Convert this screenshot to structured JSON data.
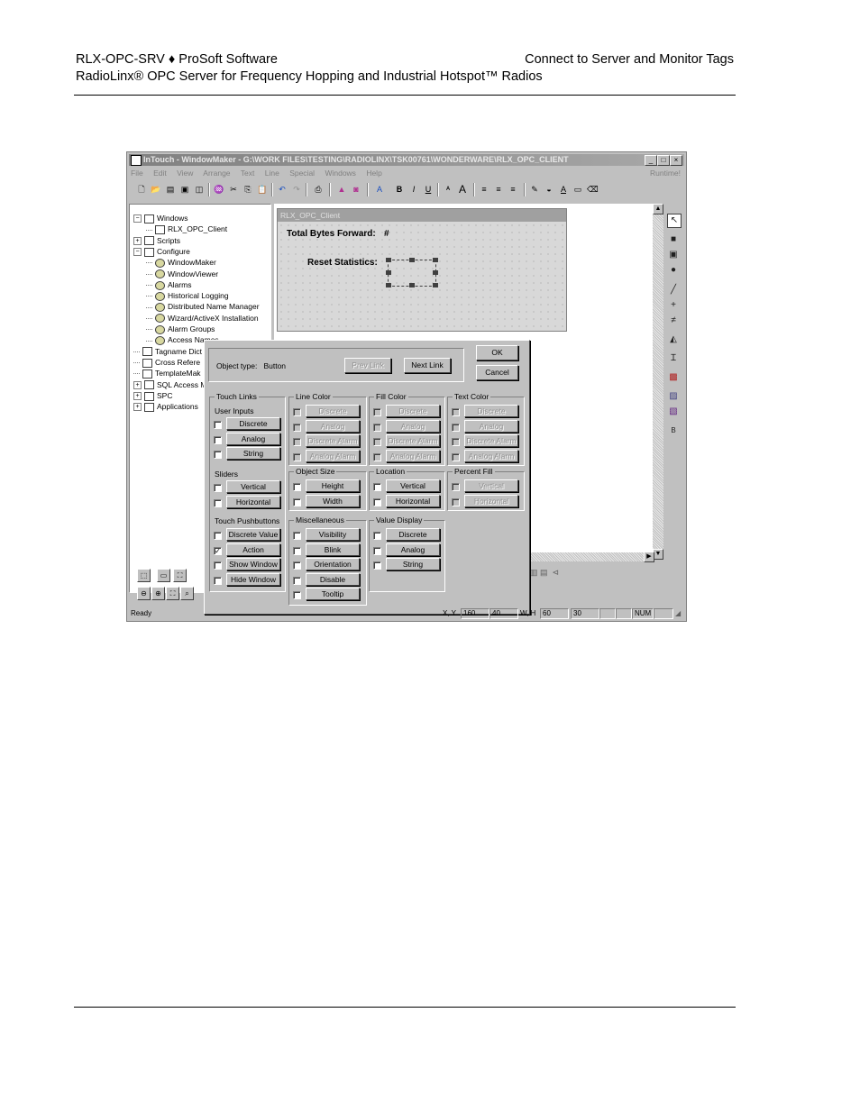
{
  "header": {
    "left_line1": "RLX-OPC-SRV ♦ ProSoft Software",
    "right_line1": "Connect to Server and Monitor Tags",
    "left_line2": "RadioLinx® OPC Server for Frequency Hopping and Industrial Hotspot™ Radios"
  },
  "app": {
    "title": "InTouch - WindowMaker - G:\\WORK FILES\\TESTING\\RADIOLINX\\TSK00761\\WONDERWARE\\RLX_OPC_CLIENT",
    "menus": [
      "File",
      "Edit",
      "View",
      "Arrange",
      "Text",
      "Line",
      "Special",
      "Windows",
      "Help"
    ],
    "runtime_label": "Runtime!",
    "window_buttons": [
      "_",
      "□",
      "×"
    ]
  },
  "tree": [
    {
      "label": "Windows",
      "expander": "−",
      "indent": 0
    },
    {
      "label": "RLX_OPC_Client",
      "expander": "",
      "indent": 1
    },
    {
      "label": "Scripts",
      "expander": "+",
      "indent": 0
    },
    {
      "label": "Configure",
      "expander": "−",
      "indent": 0
    },
    {
      "label": "WindowMaker",
      "expander": "",
      "indent": 1
    },
    {
      "label": "WindowViewer",
      "expander": "",
      "indent": 1
    },
    {
      "label": "Alarms",
      "expander": "",
      "indent": 1
    },
    {
      "label": "Historical Logging",
      "expander": "",
      "indent": 1
    },
    {
      "label": "Distributed Name Manager",
      "expander": "",
      "indent": 1
    },
    {
      "label": "Wizard/ActiveX Installation",
      "expander": "",
      "indent": 1
    },
    {
      "label": "Alarm Groups",
      "expander": "",
      "indent": 1
    },
    {
      "label": "Access Names",
      "expander": "",
      "indent": 1
    },
    {
      "label": "Tagname Dict",
      "expander": "",
      "indent": 0
    },
    {
      "label": "Cross Refere",
      "expander": "",
      "indent": 0
    },
    {
      "label": "TemplateMak",
      "expander": "",
      "indent": 0
    },
    {
      "label": "SQL Access M",
      "expander": "+",
      "indent": 0
    },
    {
      "label": "SPC",
      "expander": "+",
      "indent": 0
    },
    {
      "label": "Applications",
      "expander": "+",
      "indent": 0
    }
  ],
  "rlx_window": {
    "title": "RLX_OPC_Client",
    "total_bytes_label": "Total Bytes Forward:",
    "total_bytes_value": "#",
    "reset_label": "Reset Statistics:"
  },
  "dialog": {
    "object_type_label": "Object type:",
    "object_type_value": "Button",
    "prev_link": "Prev Link",
    "next_link": "Next Link",
    "ok": "OK",
    "cancel": "Cancel",
    "groups": {
      "touch_links": {
        "title": "Touch Links",
        "user_inputs_label": "User Inputs",
        "user_inputs": [
          {
            "label": "Discrete",
            "checked": false
          },
          {
            "label": "Analog",
            "checked": false
          },
          {
            "label": "String",
            "checked": false
          }
        ],
        "sliders_label": "Sliders",
        "sliders": [
          {
            "label": "Vertical",
            "checked": false
          },
          {
            "label": "Horizontal",
            "checked": false
          }
        ],
        "pushbuttons_label": "Touch Pushbuttons",
        "pushbuttons": [
          {
            "label": "Discrete Value",
            "checked": false
          },
          {
            "label": "Action",
            "checked": true
          },
          {
            "label": "Show Window",
            "checked": false
          },
          {
            "label": "Hide Window",
            "checked": false
          }
        ]
      },
      "line_color": {
        "title": "Line Color",
        "items": [
          "Discrete",
          "Analog",
          "Discrete Alarm",
          "Analog Alarm"
        ]
      },
      "fill_color": {
        "title": "Fill Color",
        "items": [
          "Discrete",
          "Analog",
          "Discrete Alarm",
          "Analog Alarm"
        ]
      },
      "text_color": {
        "title": "Text Color",
        "items": [
          "Discrete",
          "Analog",
          "Discrete Alarm",
          "Analog Alarm"
        ]
      },
      "object_size": {
        "title": "Object Size",
        "items": [
          "Height",
          "Width"
        ]
      },
      "location": {
        "title": "Location",
        "items": [
          "Vertical",
          "Horizontal"
        ]
      },
      "percent_fill": {
        "title": "Percent Fill",
        "items": [
          "Vertical",
          "Horizontal"
        ]
      },
      "miscellaneous": {
        "title": "Miscellaneous",
        "items": [
          "Visibility",
          "Blink",
          "Orientation",
          "Disable",
          "Tooltip"
        ]
      },
      "value_display": {
        "title": "Value Display",
        "items": [
          "Discrete",
          "Analog",
          "String"
        ]
      }
    }
  },
  "statusbar": {
    "ready": "Ready",
    "xy_label": "X, Y",
    "x": "160",
    "y": "40",
    "wh_label": "W, H",
    "w": "60",
    "h": "30",
    "num": "NUM"
  },
  "colors": {
    "dialog_bg": "#c0c0c0",
    "title_inactive": "#808080"
  }
}
